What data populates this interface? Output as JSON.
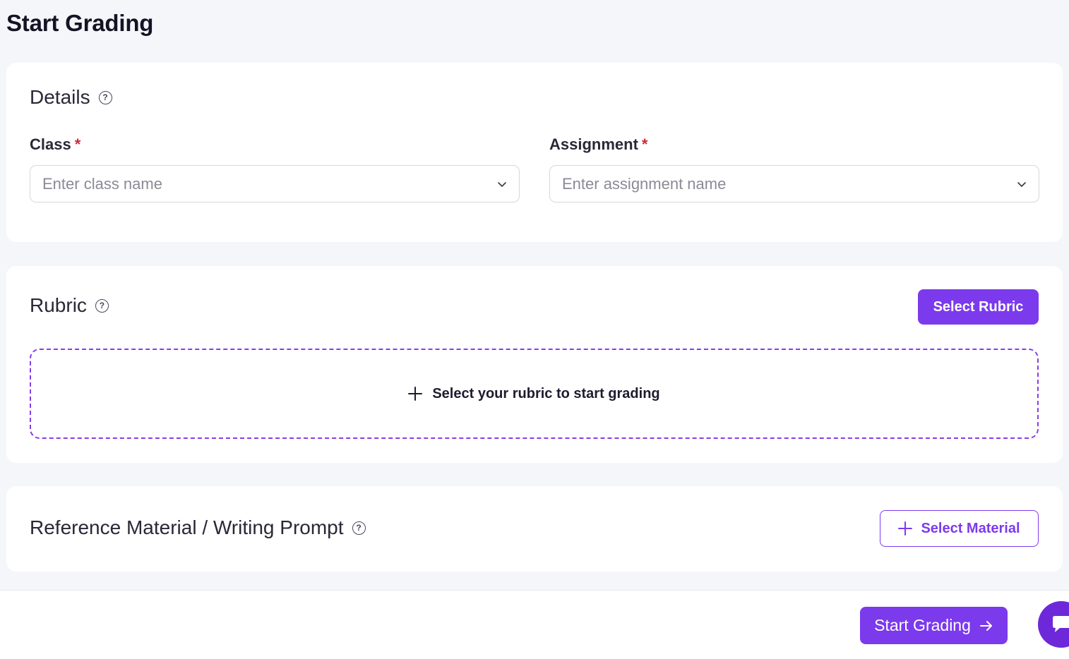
{
  "page": {
    "title": "Start Grading"
  },
  "details": {
    "title": "Details",
    "class_label": "Class",
    "class_placeholder": "Enter class name",
    "assignment_label": "Assignment",
    "assignment_placeholder": "Enter assignment name",
    "required_mark": "*"
  },
  "rubric": {
    "title": "Rubric",
    "select_button": "Select Rubric",
    "dropzone_text": "Select your rubric to start grading"
  },
  "material": {
    "title": "Reference Material / Writing Prompt",
    "select_button": "Select Material"
  },
  "footer": {
    "start_button": "Start Grading"
  },
  "icons": {
    "help": "help-circle-icon",
    "chevron": "chevron-down-icon",
    "plus": "plus-icon",
    "arrow": "arrow-right-icon",
    "chat": "chat-icon"
  },
  "colors": {
    "accent": "#7c3aed",
    "required": "#d0293b",
    "background": "#f5f6fa"
  }
}
